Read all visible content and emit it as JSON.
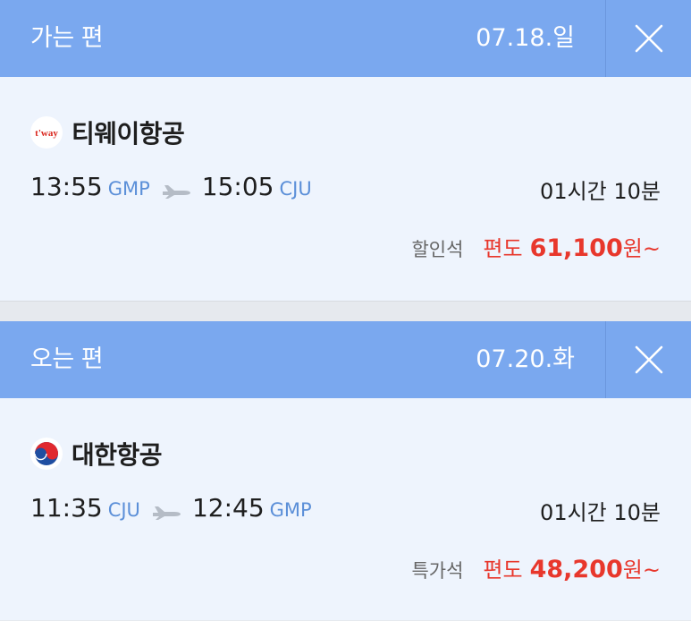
{
  "outbound": {
    "header_title": "가는 편",
    "date": "07.18.일",
    "airline": "티웨이항공",
    "logo_text": "t'way",
    "departure_time": "13:55",
    "departure_code": "GMP",
    "arrival_time": "15:05",
    "arrival_code": "CJU",
    "duration": "01시간 10분",
    "seat_class": "할인석",
    "price_prefix": "편도",
    "price": "61,100",
    "price_suffix": "원~"
  },
  "return": {
    "header_title": "오는 편",
    "date": "07.20.화",
    "airline": "대한항공",
    "departure_time": "11:35",
    "departure_code": "CJU",
    "arrival_time": "12:45",
    "arrival_code": "GMP",
    "duration": "01시간 10분",
    "seat_class": "특가석",
    "price_prefix": "편도",
    "price": "48,200",
    "price_suffix": "원~"
  },
  "colors": {
    "header": "#7aa8ef",
    "card": "#eef4fd",
    "price": "#e8372c",
    "airport_code": "#5b8fd8"
  },
  "icons": [
    "close-icon",
    "tway-logo",
    "korean-air-logo",
    "airplane-icon"
  ]
}
